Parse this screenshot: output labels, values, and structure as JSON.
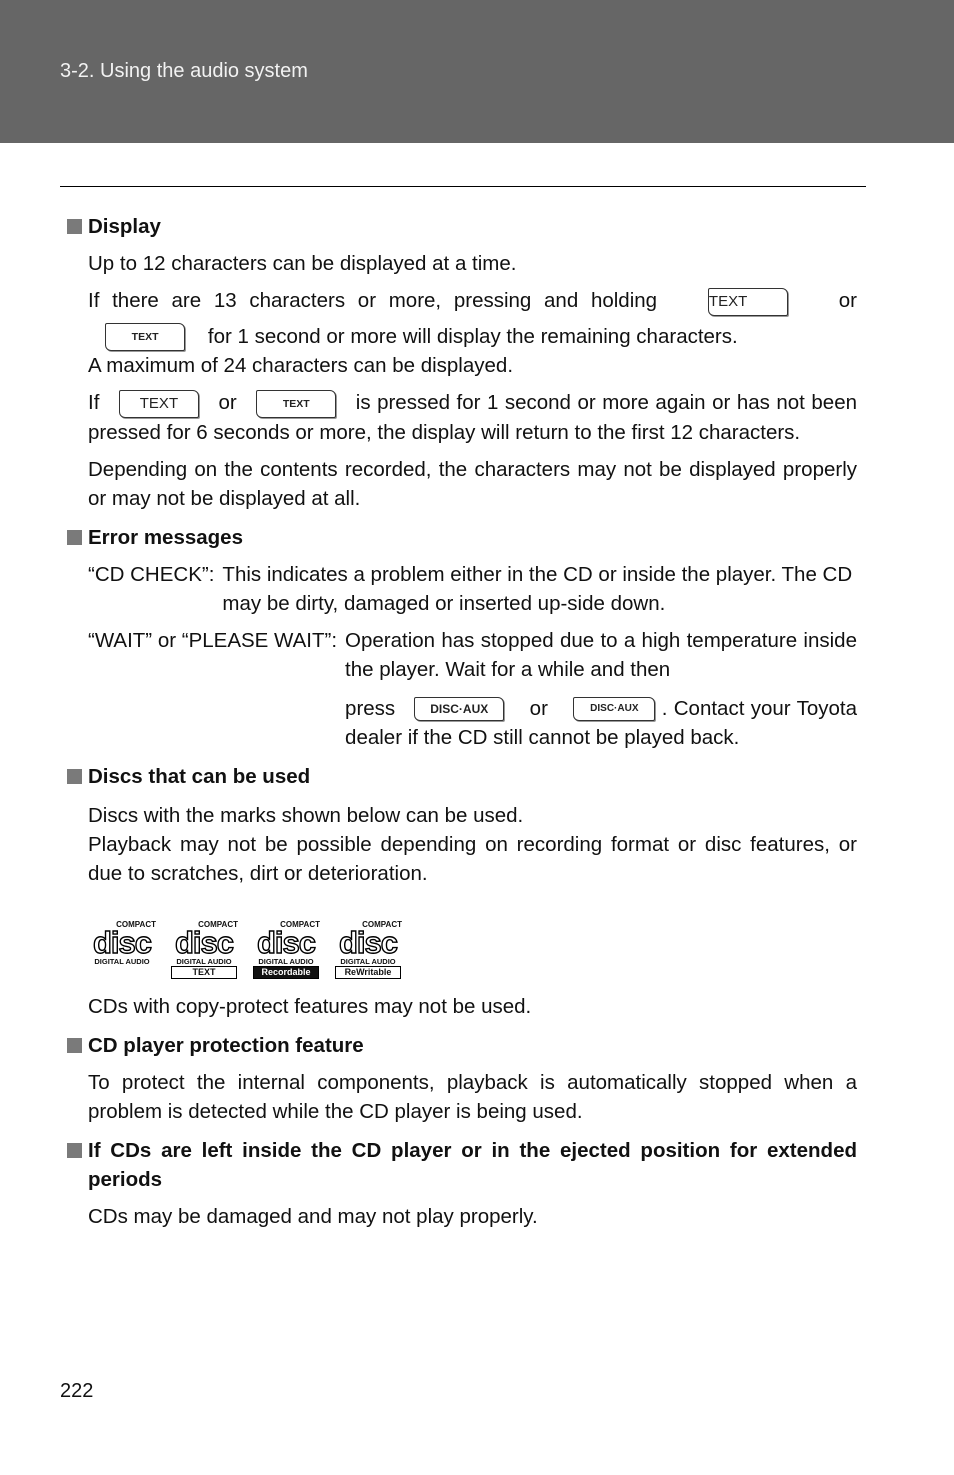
{
  "header": {
    "section_title": "3-2. Using the audio system"
  },
  "sections": {
    "display": {
      "heading": "Display",
      "p1": "Up to 12 characters can be displayed at a time.",
      "p2_a": "If there are 13 characters or more, pressing and holding",
      "p2_or": "or",
      "p2_b": "for 1 second or more will display the remaining characters.",
      "p3": "A maximum of 24 characters can be displayed.",
      "p4_if": "If",
      "p4_or": "or",
      "p4_b": "is pressed for 1 second or more again or has not been pressed for 6 seconds or more, the display will return to the first 12 characters.",
      "p5": "Depending on the contents recorded, the characters may not be displayed properly or may not be displayed at all.",
      "text_button_label": "TEXT"
    },
    "errors": {
      "heading": "Error messages",
      "items": [
        {
          "label": "“CD CHECK”:",
          "text": "This indicates a problem either in the CD or inside the player. The CD may be dirty, damaged or inserted up-side down."
        },
        {
          "label": "“WAIT” or “PLEASE WAIT”:",
          "text_a": "Operation has stopped due to a high temperature inside the player. Wait for a while and then",
          "press": "press",
          "or": "or",
          "text_b": ". Contact your Toyota dealer if the CD still cannot be played back."
        }
      ],
      "disc_button_label": "DISC·AUX"
    },
    "discs": {
      "heading": "Discs that can be used",
      "p1": "Discs with the marks shown below can be used.",
      "p2": "Playback may not be possible depending on recording format or disc features, or due to scratches, dirt or deterioration.",
      "logos": [
        {
          "top": "COMPACT",
          "mark": "disc",
          "sub": "DIGITAL AUDIO",
          "tag": ""
        },
        {
          "top": "COMPACT",
          "mark": "disc",
          "sub": "DIGITAL AUDIO",
          "tag": "TEXT"
        },
        {
          "top": "COMPACT",
          "mark": "disc",
          "sub": "DIGITAL AUDIO",
          "tag": "Recordable"
        },
        {
          "top": "COMPACT",
          "mark": "disc",
          "sub": "DIGITAL AUDIO",
          "tag": "ReWritable"
        }
      ],
      "p3": "CDs with copy-protect features may not be used."
    },
    "protection": {
      "heading": "CD player protection feature",
      "p1": "To protect the internal components, playback is automatically stopped when a problem is detected while the CD player is being used."
    },
    "left_inside": {
      "heading": "If CDs are left inside the CD player or in the ejected position for extended periods",
      "p1": "CDs may be damaged and may not play properly."
    }
  },
  "footer": {
    "page_number": "222"
  }
}
